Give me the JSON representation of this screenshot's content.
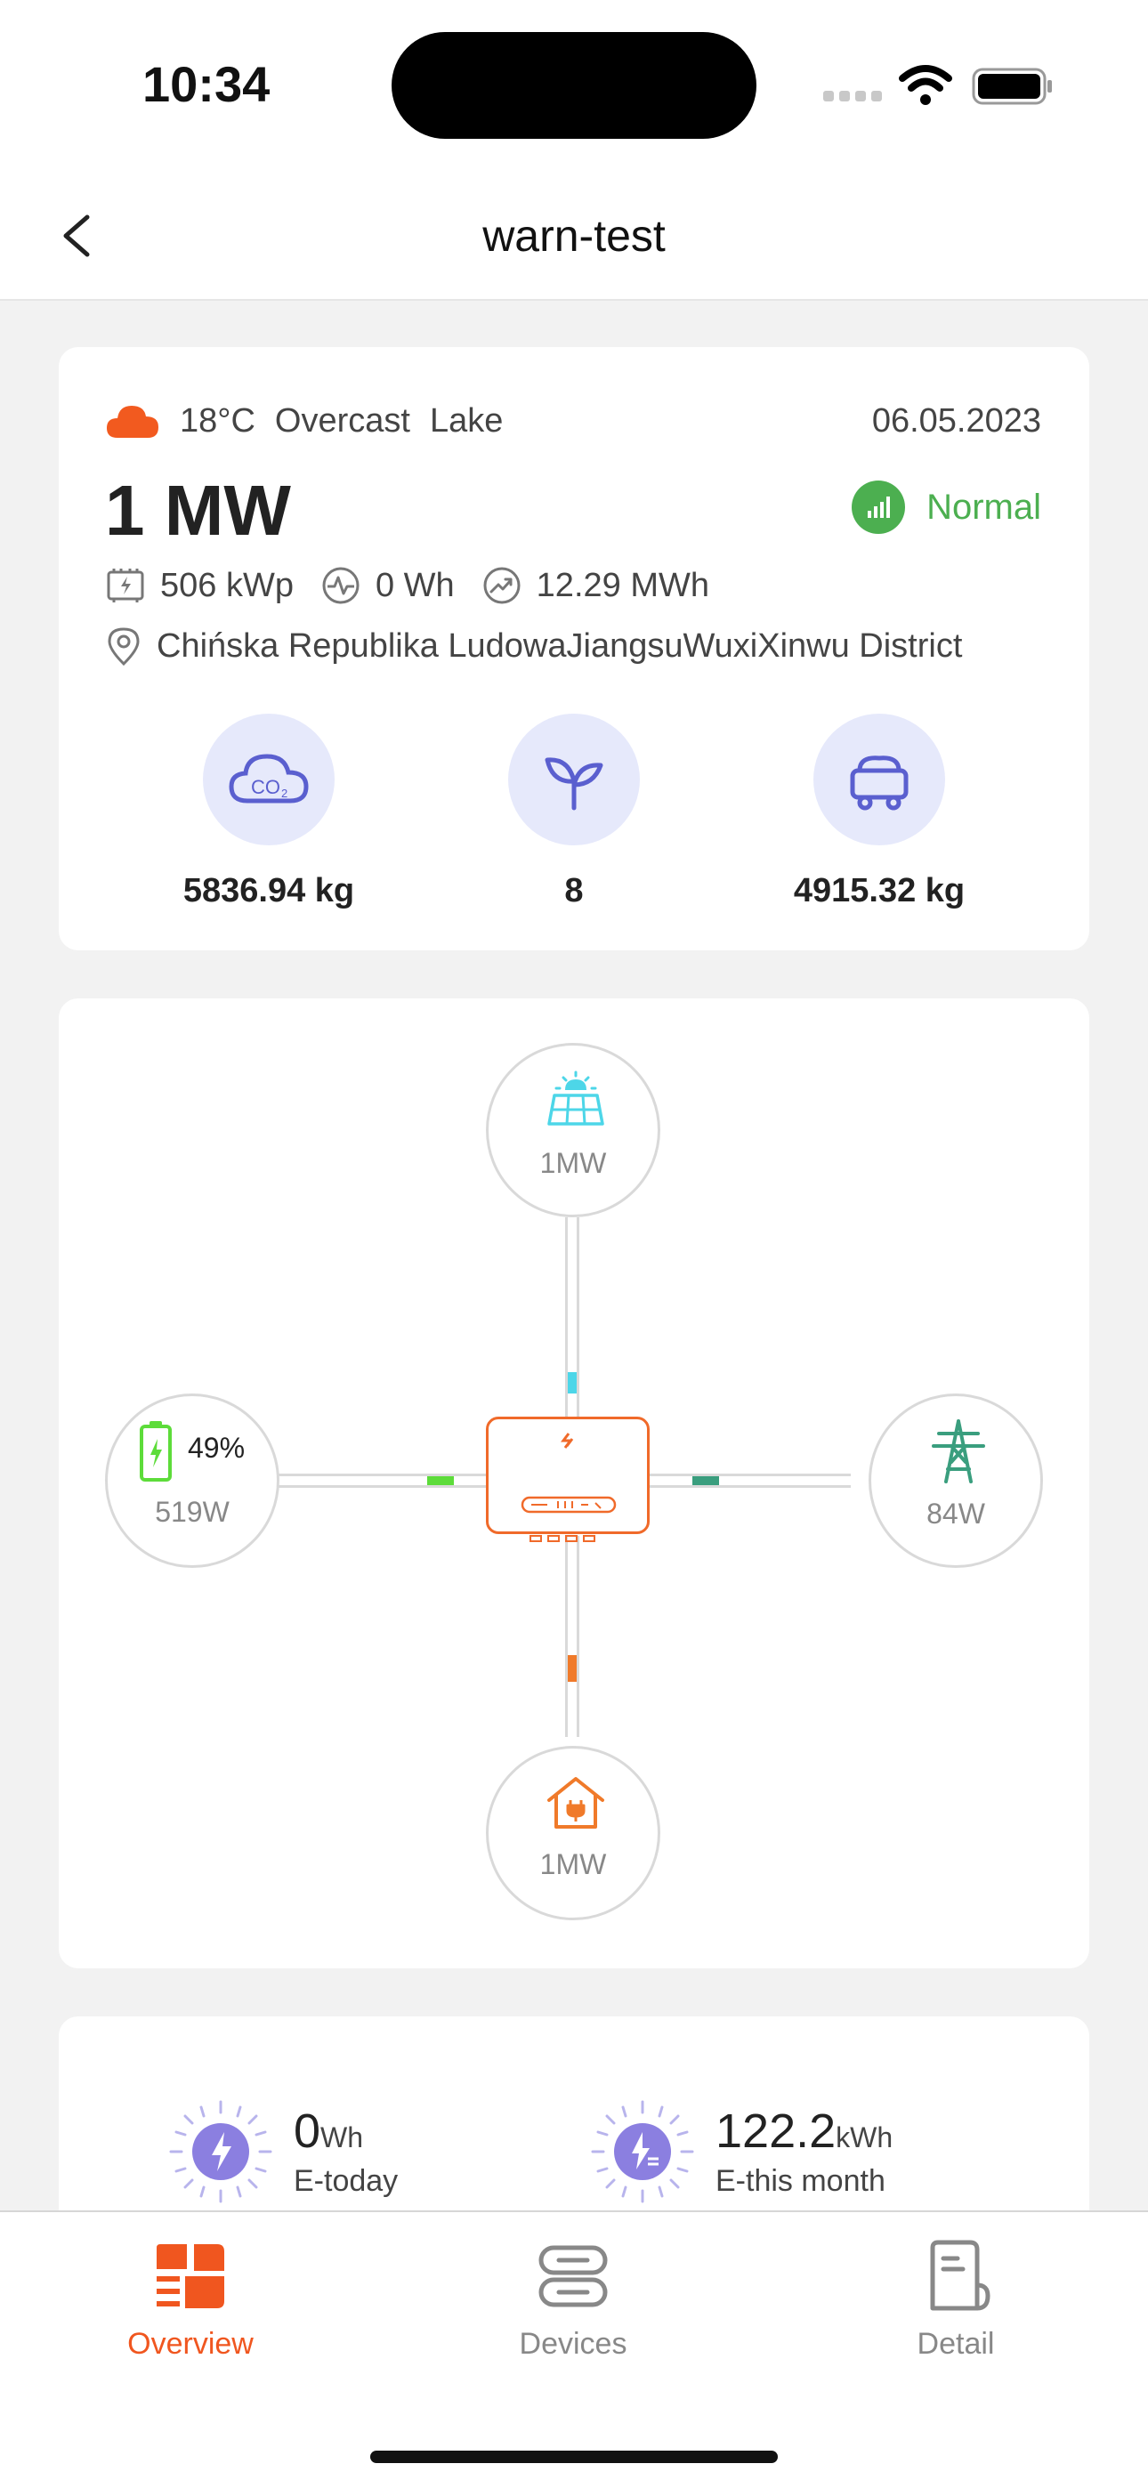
{
  "status_bar": {
    "time": "10:34"
  },
  "nav": {
    "title": "warn-test"
  },
  "overview": {
    "temperature": "18°C",
    "weather": "Overcast",
    "location_name": "Lake",
    "date": "06.05.2023",
    "capacity": "1 MW",
    "status": "Normal",
    "installed_power": "506 kWp",
    "current_energy": "0 Wh",
    "total_energy": "12.29 MWh",
    "address": "Chińska Republika LudowaJiangsuWuxiXinwu District",
    "co2_saved": "5836.94 kg",
    "trees": "8",
    "coal_saved": "4915.32 kg"
  },
  "flow": {
    "solar": "1MW",
    "battery_percent": "49%",
    "battery_power": "519W",
    "grid": "84W",
    "home": "1MW"
  },
  "energy": {
    "today_value": "0",
    "today_unit": "Wh",
    "today_label": "E-today",
    "month_value": "122.2",
    "month_unit": "kWh",
    "month_label": "E-this month"
  },
  "tabs": [
    {
      "label": "Overview"
    },
    {
      "label": "Devices"
    },
    {
      "label": "Detail"
    }
  ],
  "colors": {
    "accent": "#f0561f",
    "normal": "#4caf50",
    "eco_bg": "#e6e9fb",
    "solar": "#4dd6e8",
    "battery": "#5ddc3a",
    "grid": "#3a9e7e",
    "home": "#f07a2a"
  }
}
